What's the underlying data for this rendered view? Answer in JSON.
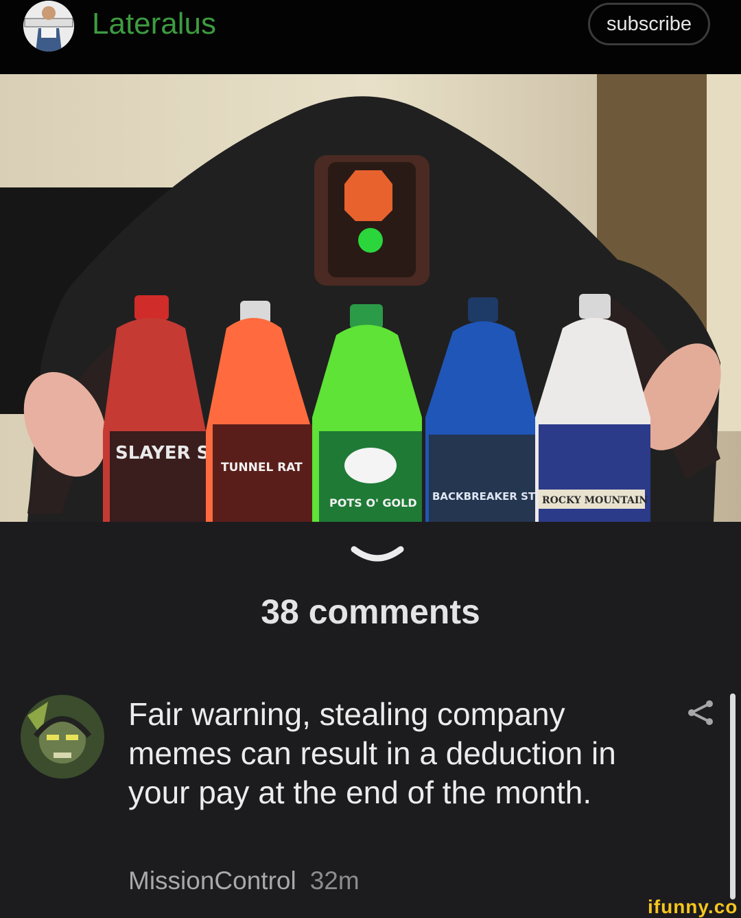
{
  "header": {
    "channel_name": "Lateralus",
    "subscribe_label": "subscribe"
  },
  "post": {
    "bottle_labels": [
      "SLAYER STOUT",
      "TUNNEL RAT",
      "POTS O' GOLD",
      "BACKBREAKER STOUT",
      "ROCKY MOUNTAIN"
    ]
  },
  "comments_section": {
    "count_label": "38 comments"
  },
  "comment": {
    "text": "Fair warning, stealing company memes can result in a deduction in your pay at the end of the month.",
    "author": "MissionControl",
    "time": "32m"
  },
  "watermark": "ifunny.co",
  "colors": {
    "channel_green": "#3d9b41",
    "background": "#1c1c1f",
    "watermark_yellow": "#f7c51e"
  },
  "icons": [
    "chevron-down-icon",
    "share-icon"
  ]
}
